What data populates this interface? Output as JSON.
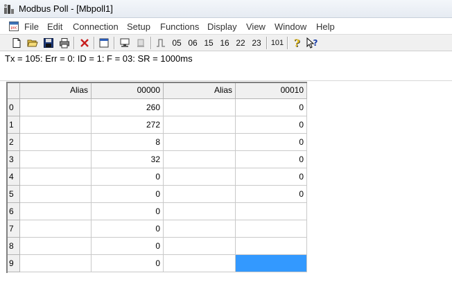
{
  "window": {
    "title": "Modbus Poll - [Mbpoll1]"
  },
  "menu": {
    "file": "File",
    "edit": "Edit",
    "connection": "Connection",
    "setup": "Setup",
    "functions": "Functions",
    "display": "Display",
    "view": "View",
    "window": "Window",
    "help": "Help"
  },
  "toolbar": {
    "fc05": "05",
    "fc06": "06",
    "fc15": "15",
    "fc16": "16",
    "fc22": "22",
    "fc23": "23",
    "fc101": "101"
  },
  "status": {
    "text": "Tx = 105: Err = 0: ID = 1: F = 03: SR = 1000ms"
  },
  "grid": {
    "headers": {
      "alias1": "Alias",
      "addr1": "00000",
      "alias2": "Alias",
      "addr2": "00010"
    },
    "rows": [
      {
        "index": "0",
        "alias1": "",
        "value1": "260",
        "alias2": "",
        "value2": "0"
      },
      {
        "index": "1",
        "alias1": "",
        "value1": "272",
        "alias2": "",
        "value2": "0"
      },
      {
        "index": "2",
        "alias1": "",
        "value1": "8",
        "alias2": "",
        "value2": "0"
      },
      {
        "index": "3",
        "alias1": "",
        "value1": "32",
        "alias2": "",
        "value2": "0"
      },
      {
        "index": "4",
        "alias1": "",
        "value1": "0",
        "alias2": "",
        "value2": "0"
      },
      {
        "index": "5",
        "alias1": "",
        "value1": "0",
        "alias2": "",
        "value2": "0"
      },
      {
        "index": "6",
        "alias1": "",
        "value1": "0",
        "alias2": "",
        "value2": ""
      },
      {
        "index": "7",
        "alias1": "",
        "value1": "0",
        "alias2": "",
        "value2": ""
      },
      {
        "index": "8",
        "alias1": "",
        "value1": "0",
        "alias2": "",
        "value2": ""
      },
      {
        "index": "9",
        "alias1": "",
        "value1": "0",
        "alias2": "",
        "value2": ""
      }
    ],
    "selected_row": 9,
    "selected_column": "value2"
  },
  "colors": {
    "selection": "#3399ff",
    "header_bg": "#f0f0f0",
    "grid_line": "#c9c9c9"
  },
  "icons": {
    "app": "modbus-app-icon",
    "doc": "document-icon",
    "new": "new-file-icon",
    "open": "open-folder-icon",
    "save": "save-icon",
    "print": "printer-icon",
    "delete": "delete-x-icon",
    "window": "window-icon",
    "connect": "connect-icon",
    "disconnect": "disconnect-icon",
    "pulse": "pulse-icon",
    "about": "question-icon",
    "context-help": "context-help-icon"
  }
}
